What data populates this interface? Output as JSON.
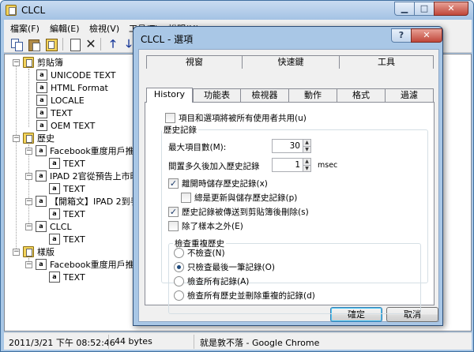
{
  "main": {
    "title": "CLCL",
    "menu": [
      "檔案(F)",
      "編輯(E)",
      "檢視(V)",
      "工具(T)",
      "說明(H)"
    ],
    "window_buttons": {
      "minimize": "▁",
      "maximize": "□",
      "close": "✕"
    },
    "toolbar": {
      "delete": "✕",
      "up": "🡑",
      "down": "🡓"
    }
  },
  "tree": {
    "clipboard": "剪貼簿",
    "fmt_unicode": "UNICODE TEXT",
    "fmt_html": "HTML Format",
    "fmt_locale": "LOCALE",
    "fmt_text": "TEXT",
    "fmt_oem": "OEM TEXT",
    "history": "歷史",
    "h1": "Facebook重度用戶推翻",
    "h1_text": "TEXT",
    "h2": "IPAD 2官從預告上市時",
    "h2_text": "TEXT",
    "h3": "【開箱文】IPAD 2到手",
    "h3_text": "TEXT",
    "h4": "CLCL",
    "h4_text": "TEXT",
    "template": "樣版",
    "t1": "Facebook重度用戶推翻",
    "t1_text": "TEXT",
    "doc_glyph": "a",
    "expanded": "−"
  },
  "status": {
    "datetime": "2011/3/21 下午 08:52:46",
    "size": "44 bytes",
    "window": "就是敦不落 - Google Chrome"
  },
  "dialog": {
    "title": "CLCL - 選項",
    "help": "?",
    "close": "✕",
    "tabs_back": [
      "視窗",
      "快速鍵",
      "工具"
    ],
    "tabs_front": [
      "History",
      "功能表",
      "檢視器",
      "動作",
      "格式",
      "過濾"
    ],
    "shared_checkbox": "項目和選項將被所有使用者共用(u)",
    "history_group": "歷史記錄",
    "max_items_label": "最大項目數(M):",
    "max_items_value": "30",
    "delay_label": "間置多久後加入歷史記錄",
    "delay_value": "1",
    "delay_unit": "msec",
    "cb_save_on_exit": "離開時儲存歷史記錄(x)",
    "cb_always_save": "總是更新與儲存歷史記錄(p)",
    "cb_delete_after_send": "歷史記錄被傳送到剪貼簿後刪除(s)",
    "cb_except_template": "除了樣本之外(E)",
    "dup_group": "檢查重複歷史",
    "radio_none": "不檢查(N)",
    "radio_last": "只檢查最後一筆記錄(O)",
    "radio_all": "檢查所有記錄(A)",
    "radio_all_delete": "檢查所有歷史並刪除重複的記錄(d)",
    "ok": "確定",
    "cancel": "取消",
    "check_mark": "✓"
  },
  "colors": {
    "title_bar": "#a9c7e6",
    "close_button": "#c0473a",
    "dialog_face": "#f0f0f0"
  }
}
